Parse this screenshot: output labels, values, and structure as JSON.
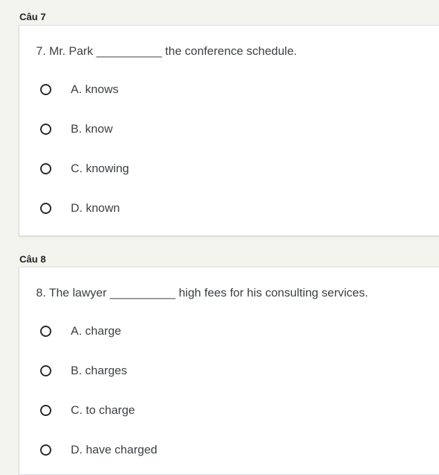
{
  "questions": [
    {
      "section_label": "Câu 7",
      "text": "7. Mr. Park __________ the conference schedule.",
      "options": [
        "A. knows",
        "B. know",
        "C. knowing",
        "D. known"
      ]
    },
    {
      "section_label": "Câu 8",
      "text": "8. The lawyer __________ high fees for his consulting services.",
      "options": [
        "A. charge",
        "B. charges",
        "C. to charge",
        "D. have charged"
      ]
    }
  ]
}
